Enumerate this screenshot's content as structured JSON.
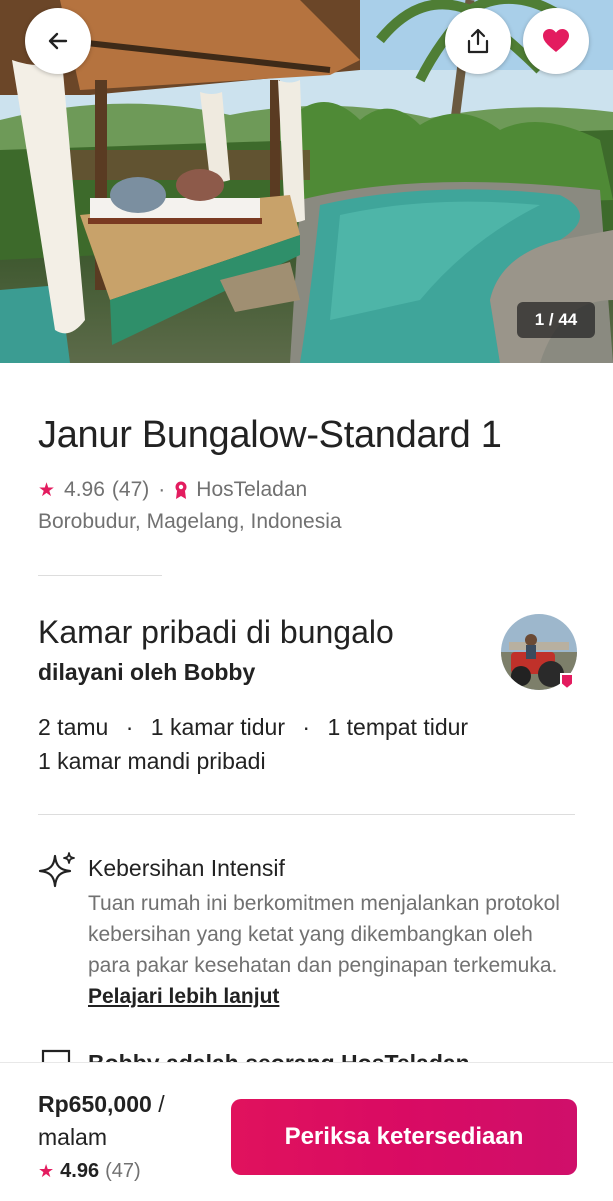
{
  "hero": {
    "photo_counter": "1 / 44",
    "back_icon": "arrow-left-icon",
    "share_icon": "share-icon",
    "like_icon": "heart-icon",
    "heart_color": "#e31c5f"
  },
  "listing": {
    "title": "Janur Bungalow-Standard 1",
    "rating": "4.96",
    "review_count": "(47)",
    "host_badge": "HosTeladan",
    "location": "Borobudur, Magelang, Indonesia"
  },
  "room": {
    "title": "Kamar pribadi di bungalo",
    "host_line": "dilayani oleh Bobby",
    "guests": "2 tamu",
    "bedrooms": "1 kamar tidur",
    "beds": "1 tempat tidur",
    "baths": "1 kamar mandi pribadi"
  },
  "highlights": [
    {
      "icon": "sparkle-icon",
      "title": "Kebersihan Intensif",
      "description": "Tuan rumah ini berkomitmen menjalankan protokol kebersihan yang ketat yang dikembangkan oleh para pakar kesehatan dan penginapan terkemuka.",
      "link": "Pelajari lebih lanjut"
    },
    {
      "icon": "medal-icon",
      "title": "Bobby adalah seorang HosTeladan"
    }
  ],
  "booking": {
    "price": "Rp650,000",
    "per_slash": "/",
    "unit": "malam",
    "rating": "4.96",
    "review_count": "(47)",
    "cta_label": "Periksa ketersediaan",
    "accent_color": "#e31c5f"
  }
}
